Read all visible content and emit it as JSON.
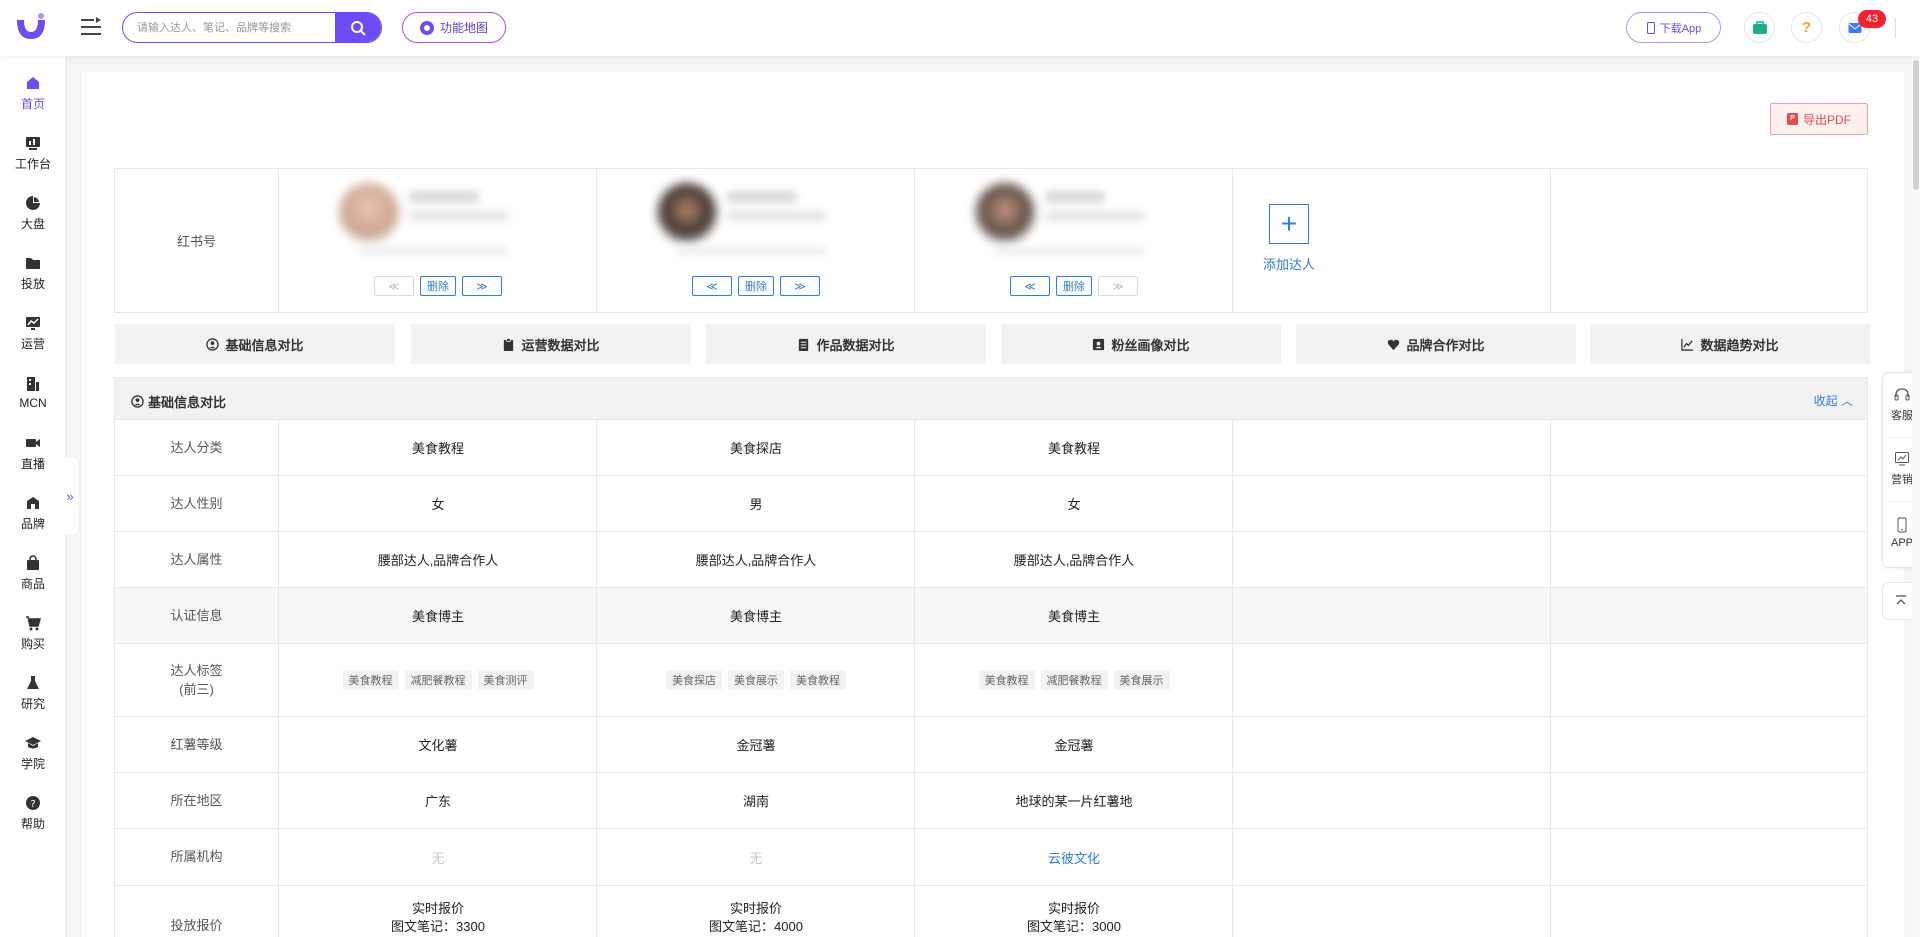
{
  "header": {
    "search_placeholder": "请输入达人、笔记、品牌等搜索",
    "feature_map_label": "功能地图",
    "download_app_label": "下载App",
    "notification_count": "43"
  },
  "sidebar": {
    "items": [
      {
        "label": "首页",
        "icon": "home-icon",
        "active": true
      },
      {
        "label": "工作台",
        "icon": "workbench-icon"
      },
      {
        "label": "大盘",
        "icon": "pie-chart-icon"
      },
      {
        "label": "投放",
        "icon": "folder-icon"
      },
      {
        "label": "运营",
        "icon": "trend-chart-icon"
      },
      {
        "label": "MCN",
        "icon": "building-icon"
      },
      {
        "label": "直播",
        "icon": "video-camera-icon"
      },
      {
        "label": "品牌",
        "icon": "brand-bag-icon"
      },
      {
        "label": "商品",
        "icon": "shopping-bag-icon"
      },
      {
        "label": "购买",
        "icon": "cart-icon"
      },
      {
        "label": "研究",
        "icon": "flask-icon"
      },
      {
        "label": "学院",
        "icon": "graduation-cap-icon"
      },
      {
        "label": "帮助",
        "icon": "help-circle-icon"
      }
    ]
  },
  "export_pdf_label": "导出PDF",
  "compare": {
    "row_label": "红书号",
    "delete_label": "删除",
    "prev_glyph": "≪",
    "next_glyph": "≫",
    "add_label": "添加达人"
  },
  "tabs": [
    {
      "label": "基础信息对比",
      "icon": "user-circle-icon"
    },
    {
      "label": "运营数据对比",
      "icon": "clipboard-icon"
    },
    {
      "label": "作品数据对比",
      "icon": "document-icon"
    },
    {
      "label": "粉丝画像对比",
      "icon": "id-card-icon"
    },
    {
      "label": "品牌合作对比",
      "icon": "heart-icon"
    },
    {
      "label": "数据趋势对比",
      "icon": "line-chart-icon"
    }
  ],
  "section": {
    "title": "基础信息对比",
    "collapse_label": "收起"
  },
  "rows": [
    {
      "label": "达人分类",
      "values": [
        "美食教程",
        "美食探店",
        "美食教程"
      ]
    },
    {
      "label": "达人性别",
      "values": [
        "女",
        "男",
        "女"
      ]
    },
    {
      "label": "达人属性",
      "values": [
        "腰部达人,品牌合作人",
        "腰部达人,品牌合作人",
        "腰部达人,品牌合作人"
      ]
    },
    {
      "label": "认证信息",
      "values": [
        "美食博主",
        "美食博主",
        "美食博主"
      ]
    },
    {
      "label": "达人标签",
      "label2": "(前三)",
      "tags": [
        [
          "美食教程",
          "减肥餐教程",
          "美食测评"
        ],
        [
          "美食探店",
          "美食展示",
          "美食教程"
        ],
        [
          "美食教程",
          "减肥餐教程",
          "美食展示"
        ]
      ]
    },
    {
      "label": "红薯等级",
      "values": [
        "文化薯",
        "金冠薯",
        "金冠薯"
      ]
    },
    {
      "label": "所在地区",
      "values": [
        "广东",
        "湖南",
        "地球的某一片红薯地"
      ]
    },
    {
      "label": "所属机构",
      "values": [
        "无",
        "无",
        "云彼文化"
      ]
    },
    {
      "label": "投放报价",
      "values": [
        "实时报价",
        "实时报价",
        "实时报价"
      ],
      "values2": [
        "图文笔记：3300",
        "图文笔记：4000",
        "图文笔记：3000"
      ]
    }
  ],
  "float_panel": {
    "service_label": "客服",
    "marketing_label": "营销",
    "app_label": "APP"
  }
}
